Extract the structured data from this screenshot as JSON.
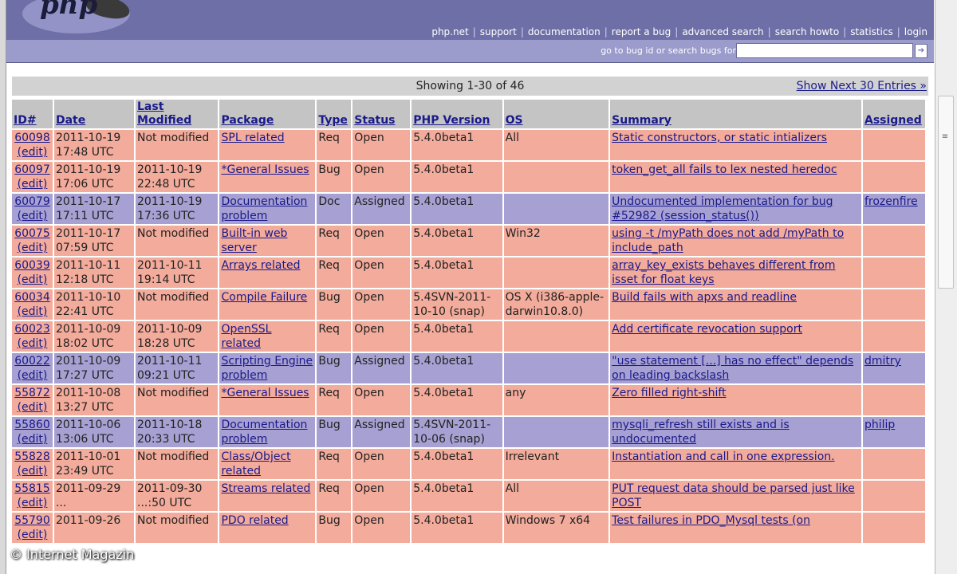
{
  "header": {
    "logo_text": "php",
    "nav": [
      "php.net",
      "support",
      "documentation",
      "report a bug",
      "advanced search",
      "search howto",
      "statistics",
      "login"
    ]
  },
  "search": {
    "label": "go to bug id or search bugs for",
    "value": ""
  },
  "results": {
    "showing": "Showing 1-30 of 46",
    "next": "Show Next 30 Entries »"
  },
  "table": {
    "columns": [
      "ID#",
      "Date",
      "Last Modified",
      "Package",
      "Type",
      "Status",
      "PHP Version",
      "OS",
      "Summary",
      "Assigned"
    ],
    "edit_label": "(edit)",
    "rows": [
      {
        "id": "60098",
        "date": "2011-10-19 17:48 UTC",
        "modified": "Not modified",
        "package": "SPL related",
        "type": "Req",
        "status": "Open",
        "version": "5.4.0beta1",
        "os": "All",
        "summary": "Static constructors, or static intializers",
        "assigned": ""
      },
      {
        "id": "60097",
        "date": "2011-10-19 17:06 UTC",
        "modified": "2011-10-19 22:48 UTC",
        "package": "*General Issues",
        "type": "Bug",
        "status": "Open",
        "version": "5.4.0beta1",
        "os": "",
        "summary": "token_get_all fails to lex nested heredoc",
        "assigned": ""
      },
      {
        "id": "60079",
        "date": "2011-10-17 17:11 UTC",
        "modified": "2011-10-19 17:36 UTC",
        "package": "Documentation problem",
        "type": "Doc",
        "status": "Assigned",
        "version": "5.4.0beta1",
        "os": "",
        "summary": "Undocumented implementation for bug #52982 (session_status())",
        "assigned": "frozenfire"
      },
      {
        "id": "60075",
        "date": "2011-10-17 07:59 UTC",
        "modified": "Not modified",
        "package": "Built-in web server",
        "type": "Req",
        "status": "Open",
        "version": "5.4.0beta1",
        "os": "Win32",
        "summary": "using -t /myPath does not add /myPath to include_path",
        "assigned": ""
      },
      {
        "id": "60039",
        "date": "2011-10-11 12:18 UTC",
        "modified": "2011-10-11 19:14 UTC",
        "package": "Arrays related",
        "type": "Req",
        "status": "Open",
        "version": "5.4.0beta1",
        "os": "",
        "summary": "array_key_exists behaves different from isset for float keys",
        "assigned": ""
      },
      {
        "id": "60034",
        "date": "2011-10-10 22:41 UTC",
        "modified": "Not modified",
        "package": "Compile Failure",
        "type": "Bug",
        "status": "Open",
        "version": "5.4SVN-2011-10-10 (snap)",
        "os": "OS X (i386-apple-darwin10.8.0)",
        "summary": "Build fails with apxs and readline",
        "assigned": ""
      },
      {
        "id": "60023",
        "date": "2011-10-09 18:02 UTC",
        "modified": "2011-10-09 18:28 UTC",
        "package": "OpenSSL related",
        "type": "Req",
        "status": "Open",
        "version": "5.4.0beta1",
        "os": "",
        "summary": "Add certificate revocation support",
        "assigned": ""
      },
      {
        "id": "60022",
        "date": "2011-10-09 17:27 UTC",
        "modified": "2011-10-11 09:21 UTC",
        "package": "Scripting Engine problem",
        "type": "Bug",
        "status": "Assigned",
        "version": "5.4.0beta1",
        "os": "",
        "summary": "\"use statement [...] has no effect\" depends on leading backslash",
        "assigned": "dmitry"
      },
      {
        "id": "55872",
        "date": "2011-10-08 13:27 UTC",
        "modified": "Not modified",
        "package": "*General Issues",
        "type": "Req",
        "status": "Open",
        "version": "5.4.0beta1",
        "os": "any",
        "summary": "Zero filled right-shift",
        "assigned": ""
      },
      {
        "id": "55860",
        "date": "2011-10-06 13:06 UTC",
        "modified": "2011-10-18 20:33 UTC",
        "package": "Documentation problem",
        "type": "Bug",
        "status": "Assigned",
        "version": "5.4SVN-2011-10-06 (snap)",
        "os": "",
        "summary": "mysqli_refresh still exists and is undocumented",
        "assigned": "philip"
      },
      {
        "id": "55828",
        "date": "2011-10-01 23:49 UTC",
        "modified": "Not modified",
        "package": "Class/Object related",
        "type": "Req",
        "status": "Open",
        "version": "5.4.0beta1",
        "os": "Irrelevant",
        "summary": "Instantiation and call in one expression.",
        "assigned": ""
      },
      {
        "id": "55815",
        "date": "2011-09-29 ...",
        "modified": "2011-09-30 ...:50 UTC",
        "package": "Streams related",
        "type": "Req",
        "status": "Open",
        "version": "5.4.0beta1",
        "os": "All",
        "summary": "PUT request data should be parsed just like POST",
        "assigned": ""
      },
      {
        "id": "55790",
        "date": "2011-09-26",
        "modified": "Not modified",
        "package": "PDO related",
        "type": "Bug",
        "status": "Open",
        "version": "5.4.0beta1",
        "os": "Windows 7 x64",
        "summary": "Test failures in PDO_Mysql tests (on",
        "assigned": ""
      }
    ]
  },
  "watermark": "© Internet Magazin",
  "colors": {
    "header": "#6f6fa8",
    "open_row": "#f3ab9b",
    "assigned_row": "#a7a0d2",
    "link": "#1a1a8a"
  }
}
